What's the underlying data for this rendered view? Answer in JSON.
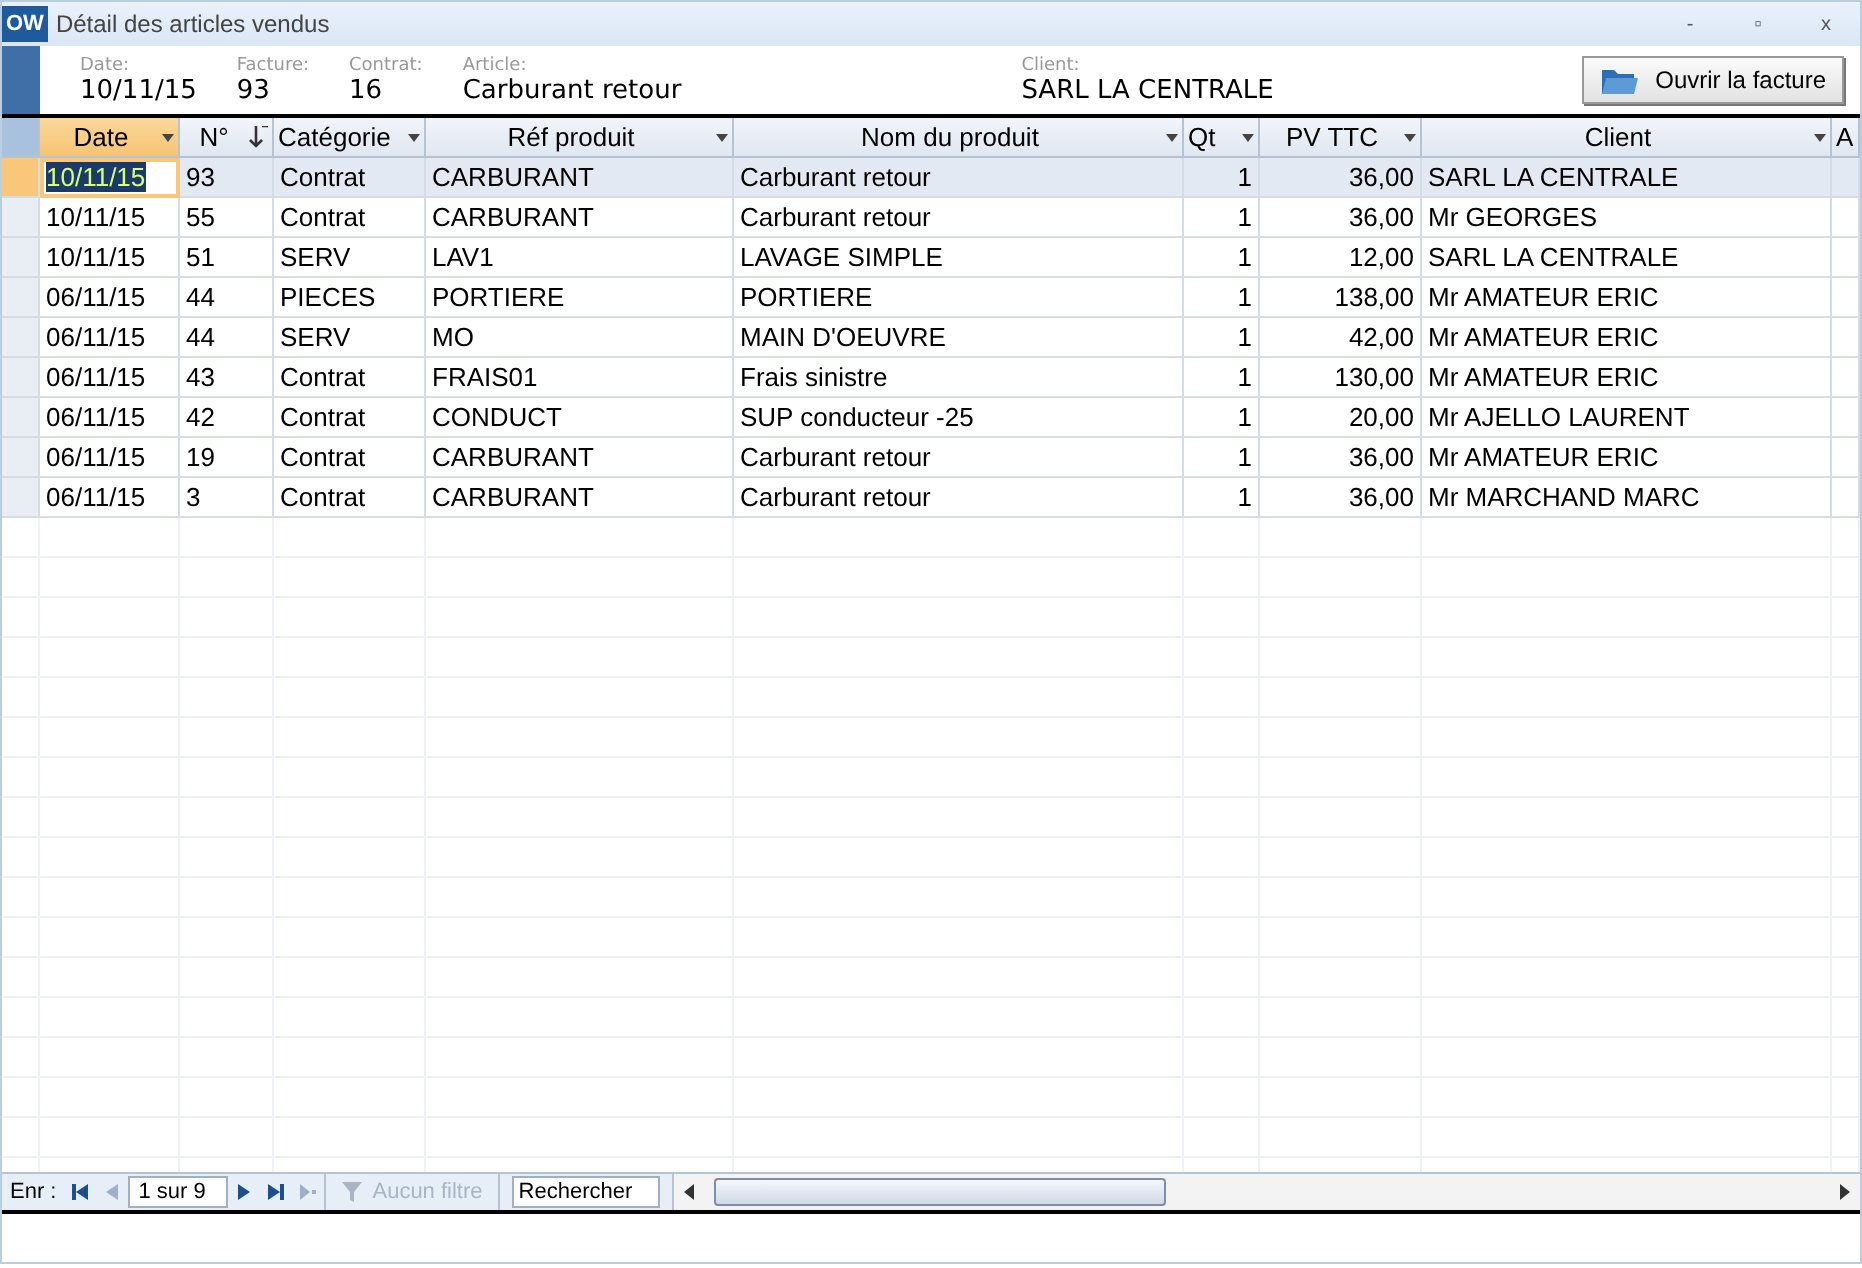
{
  "window": {
    "icon": "OW",
    "title": "Détail des articles vendus",
    "controls": [
      "-",
      "▫",
      "x"
    ]
  },
  "header_fields": [
    {
      "label": "Date:",
      "value": "10/11/15"
    },
    {
      "label": "Facture:",
      "value": "93"
    },
    {
      "label": "Contrat:",
      "value": "16"
    },
    {
      "label": "Article:",
      "value": "Carburant retour"
    },
    {
      "label": "Client:",
      "value": "SARL LA CENTRALE"
    }
  ],
  "open_button": {
    "label": "Ouvrir la facture"
  },
  "table": {
    "columns": [
      {
        "label": "Date",
        "selected": true,
        "kind": "dropdown"
      },
      {
        "label": "N°",
        "selected": false,
        "kind": "sorted"
      },
      {
        "label": "Catégorie",
        "selected": false,
        "kind": "dropdown"
      },
      {
        "label": "Réf produit",
        "selected": false,
        "kind": "dropdown"
      },
      {
        "label": "Nom du produit",
        "selected": false,
        "kind": "dropdown"
      },
      {
        "label": "Qt",
        "selected": false,
        "kind": "dropdown"
      },
      {
        "label": "PV TTC",
        "selected": false,
        "kind": "dropdown"
      },
      {
        "label": "Client",
        "selected": false,
        "kind": "dropdown"
      },
      {
        "label": "A",
        "selected": false,
        "kind": "plain"
      }
    ],
    "rows": [
      {
        "selected": true,
        "cells": [
          "10/11/15",
          "93",
          "Contrat",
          "CARBURANT",
          "Carburant retour",
          "1",
          "36,00",
          "SARL LA CENTRALE"
        ]
      },
      {
        "selected": false,
        "cells": [
          "10/11/15",
          "55",
          "Contrat",
          "CARBURANT",
          "Carburant retour",
          "1",
          "36,00",
          "Mr  GEORGES"
        ]
      },
      {
        "selected": false,
        "cells": [
          "10/11/15",
          "51",
          "SERV",
          "LAV1",
          "LAVAGE SIMPLE",
          "1",
          "12,00",
          "SARL LA CENTRALE"
        ]
      },
      {
        "selected": false,
        "cells": [
          "06/11/15",
          "44",
          "PIECES",
          "PORTIERE",
          "PORTIERE",
          "1",
          "138,00",
          "Mr AMATEUR ERIC"
        ]
      },
      {
        "selected": false,
        "cells": [
          "06/11/15",
          "44",
          "SERV",
          "MO",
          "MAIN D'OEUVRE",
          "1",
          "42,00",
          "Mr AMATEUR ERIC"
        ]
      },
      {
        "selected": false,
        "cells": [
          "06/11/15",
          "43",
          "Contrat",
          "FRAIS01",
          "Frais sinistre",
          "1",
          "130,00",
          "Mr AMATEUR ERIC"
        ]
      },
      {
        "selected": false,
        "cells": [
          "06/11/15",
          "42",
          "Contrat",
          "CONDUCT",
          "SUP conducteur -25",
          "1",
          "20,00",
          "Mr AJELLO LAURENT"
        ]
      },
      {
        "selected": false,
        "cells": [
          "06/11/15",
          "19",
          "Contrat",
          "CARBURANT",
          "Carburant retour",
          "1",
          "36,00",
          "Mr AMATEUR ERIC"
        ]
      },
      {
        "selected": false,
        "cells": [
          "06/11/15",
          "3",
          "Contrat",
          "CARBURANT",
          "Carburant retour",
          "1",
          "36,00",
          "Mr MARCHAND MARC"
        ]
      }
    ]
  },
  "navigator": {
    "label": "Enr :",
    "position": "1 sur 9",
    "filter": {
      "label": "Aucun filtre",
      "disabled": true
    },
    "search": {
      "placeholder": "Rechercher"
    }
  }
}
